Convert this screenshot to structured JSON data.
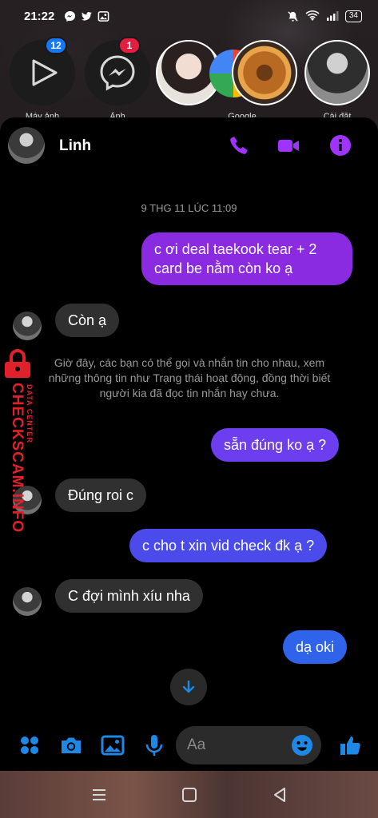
{
  "status_bar": {
    "time": "21:22",
    "battery": "34"
  },
  "chat_heads": [
    {
      "label": "Máy ảnh",
      "badge": "12",
      "badge_color": "#1877f2"
    },
    {
      "label": "Ảnh",
      "badge": "1",
      "badge_color": "#e41e3f"
    },
    {
      "label": ""
    },
    {
      "label": "Google"
    },
    {
      "label": "Cài đặt"
    }
  ],
  "conversation": {
    "contact_name": "Linh",
    "accent": "#a033ff",
    "timestamp": "9 THG 11 LÚC 11:09",
    "notice": "Giờ đây, các bạn có thể gọi và nhắn tin cho nhau, xem những thông tin như Trạng thái hoạt động, đồng thời biết người kia đã đọc tin nhắn hay chưa.",
    "messages": [
      {
        "from": "me",
        "text": "c ơi deal taekook tear + 2 card be nằm còn ko ạ",
        "color": "#8a2be2"
      },
      {
        "from": "them",
        "text": "Còn ạ"
      },
      {
        "from": "me",
        "text": "sẵn đúng ko ạ ?",
        "color": "#6d3df0"
      },
      {
        "from": "them",
        "text": "Đúng roi c"
      },
      {
        "from": "me",
        "text": "c cho t xin vid check đk ạ ?",
        "color": "#4a4bea"
      },
      {
        "from": "them",
        "text": "C đợi mình xíu nha"
      },
      {
        "from": "me",
        "text": "dạ oki",
        "color": "#2f64ea"
      }
    ]
  },
  "composer": {
    "placeholder": "Aa",
    "icon_color": "#1e88e5"
  },
  "watermark": {
    "text": "CHECKSCAM.INFO",
    "subtext": "DATA CENTER"
  }
}
